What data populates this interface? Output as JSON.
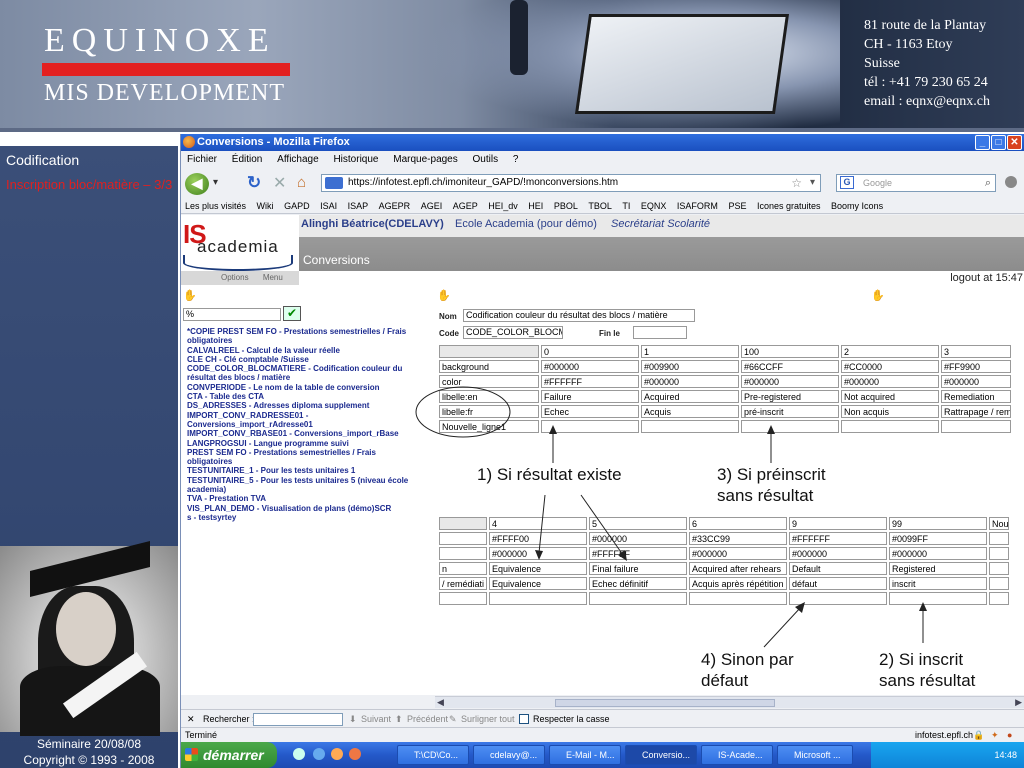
{
  "banner": {
    "logo_top": "EQUINOXE",
    "logo_bottom": "MIS DEVELOPMENT",
    "address": [
      "81 route de la Plantay",
      "CH - 1163 Etoy",
      "Suisse",
      "tél : +41 79 230 65 24",
      "email : eqnx@eqnx.ch"
    ]
  },
  "left": {
    "title": "Codification",
    "subtitle": "Inscription bloc/matière – 3/3",
    "footer_line1": "Séminaire 20/08/08",
    "footer_line2": "Copyright © 1993 - 2008"
  },
  "browser": {
    "window_title": "Conversions - Mozilla Firefox",
    "menu": [
      "Fichier",
      "Édition",
      "Affichage",
      "Historique",
      "Marque-pages",
      "Outils",
      "?"
    ],
    "url": "https://infotest.epfl.ch/imoniteur_GAPD/!monconversions.htm",
    "search_placeholder": "Google",
    "bookmarks": [
      "Les plus visités",
      "Wiki",
      "GAPD",
      "ISAI",
      "ISAP",
      "AGEPR",
      "AGEI",
      "AGEP",
      "HEI_dv",
      "HEI",
      "PBOL",
      "TBOL",
      "TI",
      "EQNX",
      "ISAFORM",
      "PSE",
      "Icones gratuites",
      "Boomy Icons"
    ]
  },
  "app": {
    "logo_is": "IS",
    "logo_academia": "academia",
    "user": "Alinghi Béatrice(CDELAVY)",
    "school": "Ecole Academia (pour démo)",
    "role": "Secrétariat Scolarité",
    "page_title": "Conversions",
    "options_label": "Options",
    "menu_label": "Menu",
    "logout": "logout at 15:47",
    "search_value": "%",
    "table_list": [
      "*COPIE PREST SEM FO - Prestations semestrielles / Frais",
      "obligatoires",
      "CALVALREEL - Calcul de la valeur réelle",
      "CLE CH - Clé comptable /Suisse",
      "CODE_COLOR_BLOCMATIERE - Codification couleur du",
      "résultat des blocs / matière",
      "CONVPERIODE - Le nom de la table de conversion",
      "CTA - Table des CTA",
      "DS_ADRESSES - Adresses diploma supplement",
      "IMPORT_CONV_RADRESSE01 -",
      "Conversions_import_rAdresse01",
      "IMPORT_CONV_RBASE01 - Conversions_import_rBase",
      "LANGPROGSUI - Langue programme suivi",
      "PREST SEM FO - Prestations semestrielles / Frais",
      "obligatoires",
      "TESTUNITAIRE_1 - Pour les tests unitaires 1",
      "TESTUNITAIRE_5 - Pour les tests unitaires 5 (niveau école",
      "academia)",
      "TVA - Prestation TVA",
      "VIS_PLAN_DEMO - Visualisation de plans (démo)SCR",
      "s - testsyrtey"
    ],
    "form": {
      "nom_label": "Nom",
      "nom_value": "Codification couleur du résultat des blocs / matière",
      "code_label": "Code",
      "code_value": "CODE_COLOR_BLOCM",
      "fin_label": "Fin le",
      "fin_value": ""
    },
    "grid1": {
      "rows": [
        [
          "",
          "0",
          "1",
          "100",
          "2",
          "3"
        ],
        [
          "background",
          "#000000",
          "#009900",
          "#66CCFF",
          "#CC0000",
          "#FF9900"
        ],
        [
          "color",
          "#FFFFFF",
          "#000000",
          "#000000",
          "#000000",
          "#000000"
        ],
        [
          "libelle:en",
          "Failure",
          "Acquired",
          "Pre-registered",
          "Not acquired",
          "Remediation"
        ],
        [
          "libelle:fr",
          "Echec",
          "Acquis",
          "pré-inscrit",
          "Non acquis",
          "Rattrapage / rem"
        ],
        [
          "Nouvelle_ligne1",
          "",
          "",
          "",
          "",
          ""
        ]
      ]
    },
    "grid2": {
      "rows": [
        [
          "",
          "4",
          "5",
          "6",
          "9",
          "99",
          "Nou"
        ],
        [
          "",
          "#FFFF00",
          "#000000",
          "#33CC99",
          "#FFFFFF",
          "#0099FF",
          ""
        ],
        [
          "",
          "#000000",
          "#FFFFFF",
          "#000000",
          "#000000",
          "#000000",
          ""
        ],
        [
          "n",
          "Equivalence",
          "Final failure",
          "Acquired after rehears",
          "Default",
          "Registered",
          ""
        ],
        [
          "/ remédiati",
          "Equivalence",
          "Echec définitif",
          "Acquis après répétition",
          "défaut",
          "inscrit",
          ""
        ],
        [
          "",
          "",
          "",
          "",
          "",
          "",
          ""
        ]
      ]
    }
  },
  "annotations": {
    "a1": "1) Si résultat existe",
    "a3_line1": "3) Si préinscrit",
    "a3_line2": "sans résultat",
    "a4_line1": "4) Sinon par",
    "a4_line2": "défaut",
    "a2_line1": "2) Si inscrit",
    "a2_line2": "sans résultat"
  },
  "findbar": {
    "close": "✕",
    "label": "Rechercher :",
    "next": "Suivant",
    "prev": "Précédent",
    "highlight": "Surligner tout",
    "match_case": "Respecter la casse"
  },
  "status": {
    "left": "Terminé",
    "right": "infotest.epfl.ch"
  },
  "taskbar": {
    "start": "démarrer",
    "items": [
      "T:\\CD\\Co...",
      "cdelavy@...",
      "E-Mail - M...",
      "Conversio...",
      "IS-Acade...",
      "Microsoft ..."
    ],
    "clock": "14:48"
  }
}
